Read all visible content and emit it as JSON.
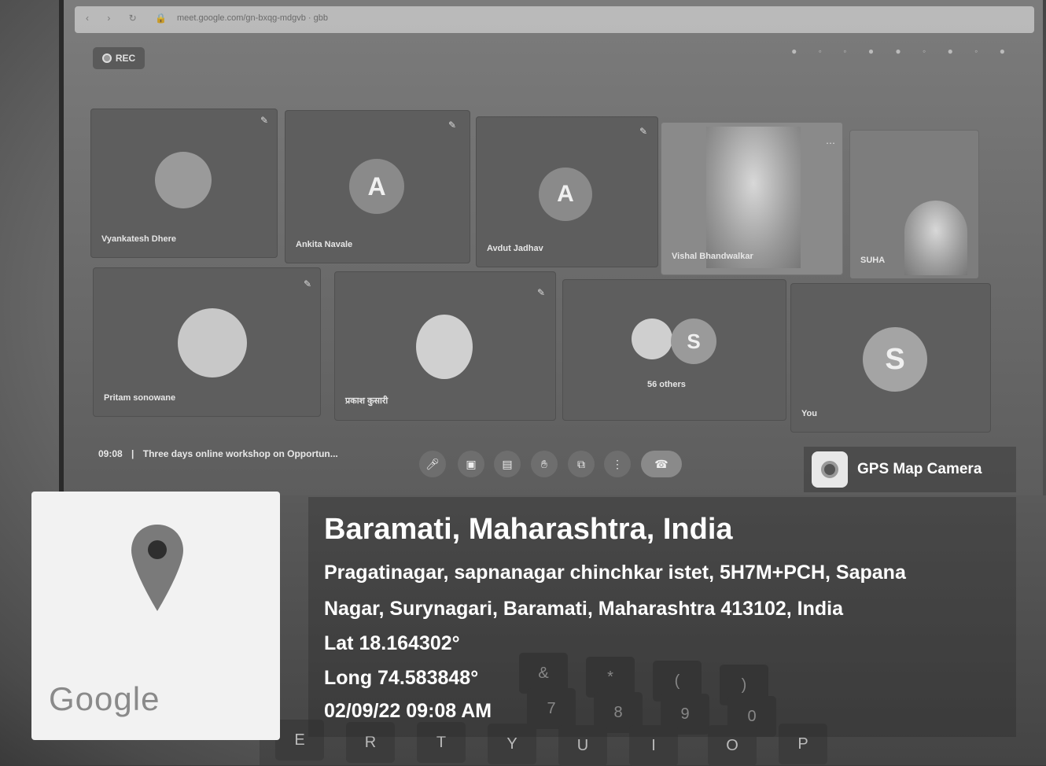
{
  "browser": {
    "url": "meet.google.com/gn-bxqg-mdgvb  ·  gbb",
    "nav_glyphs": "‹ › ↻ 🔒",
    "rec_label": "REC"
  },
  "participants": [
    {
      "name": "Vyankatesh Dhere",
      "avatar": ""
    },
    {
      "name": "Ankita Navale",
      "avatar": "A"
    },
    {
      "name": "Avdut Jadhav",
      "avatar": "A"
    },
    {
      "name": "Vishal Bhandwalkar",
      "avatar": ""
    },
    {
      "name": "SUHA",
      "avatar": ""
    },
    {
      "name": "Pritam sonowane",
      "avatar": ""
    },
    {
      "name": "प्रकाश कुसारी",
      "avatar": ""
    },
    {
      "name": "56 others",
      "avatar": "S"
    },
    {
      "name": "You",
      "avatar": "S"
    }
  ],
  "meeting": {
    "time": "09:08",
    "separator": "|",
    "title": "Three days online workshop on Opportun..."
  },
  "overlay": {
    "app_name": "GPS Map Camera",
    "google_label": "Google",
    "location_title": "Baramati, Maharashtra, India",
    "address_line1": "Pragatinagar, sapnanagar chinchkar istet, 5H7M+PCH, Sapana",
    "address_line2": "Nagar, Surynagari, Baramati, Maharashtra 413102, India",
    "lat": "Lat 18.164302°",
    "long": "Long 74.583848°",
    "datetime": "02/09/22 09:08 AM"
  },
  "keyboard_keys": [
    "&",
    "*",
    "(",
    ")",
    "7",
    "8",
    "9",
    "0",
    "E",
    "R",
    "T",
    "Y",
    "U",
    "I",
    "O",
    "P"
  ],
  "colors": {
    "map_pin": "#7a7a7a",
    "card_bg": "#f2f2f2",
    "text": "#ffffff"
  }
}
